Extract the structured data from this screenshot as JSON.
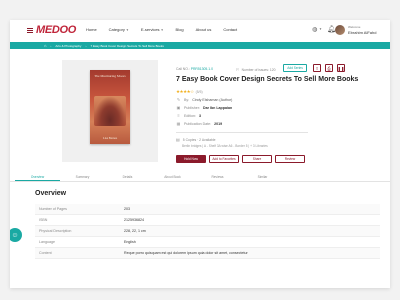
{
  "colors": {
    "brand": "#c0263b",
    "accent": "#1aa9a3",
    "primary_button": "#8b1a2b",
    "star": "#f2b01e"
  },
  "header": {
    "logo": "MEDOO",
    "nav": [
      "Home",
      "Category",
      "E-services",
      "Blog",
      "About us",
      "Contact"
    ],
    "nav_dropdowns": [
      false,
      true,
      true,
      false,
      false,
      false
    ],
    "welcome": "Welcome",
    "username": "Ebrahim AlFahd"
  },
  "breadcrumb": [
    "Arts & Photography",
    "7 Easy Book Cover Design Secrets To Sell More Books"
  ],
  "book": {
    "catalog_label": "Call NO.:",
    "catalog_no": "PRR51305.1.0",
    "in_stock_label": "Number of issues: 120",
    "add_series_label": "Add Series",
    "title": "7 Easy Book Cover Design Secrets To Sell More Books",
    "rating": 4,
    "rating_text": "(5/5)",
    "author": "Cindy Elshaman (Author)",
    "publisher_label": "Publisher:",
    "publisher": "Dar Ibn Lappaian",
    "edition_label": "Edition:",
    "edition": "3",
    "pub_date_label": "Publication Date:",
    "pub_date": "2019",
    "copies": "5 Copies · 2 Available",
    "location": "Berlin bridges | A - Shelf 3A wise A6 - Border 5 | + 3 Libraries",
    "cover": {
      "title": "The Murmuring Moors",
      "author": "Lisa Barnes"
    },
    "actions": {
      "hold": "Hold Now",
      "favorites": "Add to Favorites",
      "share": "Share",
      "review": "Review"
    }
  },
  "tabs": [
    "Overview",
    "Summary",
    "Details",
    "About Book",
    "Reviews",
    "Similar"
  ],
  "overview": {
    "title": "Overview",
    "rows": [
      {
        "label": "Number of Pages",
        "value": "203"
      },
      {
        "label": "ISBN",
        "value": "2125936824"
      },
      {
        "label": "Physical Description",
        "value": "228, 22, 1 cm"
      },
      {
        "label": "Language",
        "value": "English"
      },
      {
        "label": "Content",
        "value": "Reque porro quisquam est qui dolorem ipsum quia dolor sit amet, consectetur"
      }
    ]
  }
}
